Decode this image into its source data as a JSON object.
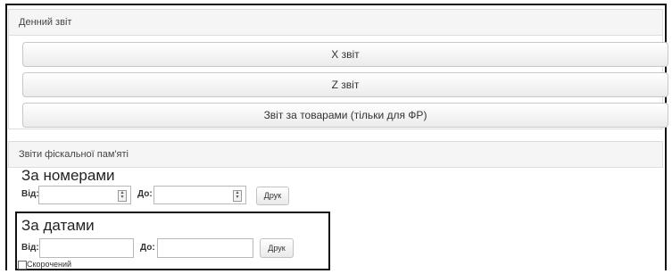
{
  "daily_report": {
    "heading": "Денний звіт",
    "buttons": [
      "X звіт",
      "Z звіт",
      "Звіт за товарами (тільки для ФР)"
    ]
  },
  "fiscal_memory": {
    "heading": "Звіти фіскальної пам'яті",
    "by_numbers": {
      "title": "За номерами",
      "from_label": "Від:",
      "to_label": "До:",
      "from_value": "",
      "to_value": "",
      "print_label": "Друк"
    },
    "by_dates": {
      "title": "За датами",
      "from_label": "Від:",
      "to_label": "До:",
      "from_value": "",
      "to_value": "",
      "print_label": "Друк",
      "short_checkbox_label": "Скорочений",
      "short_checked": false
    }
  }
}
